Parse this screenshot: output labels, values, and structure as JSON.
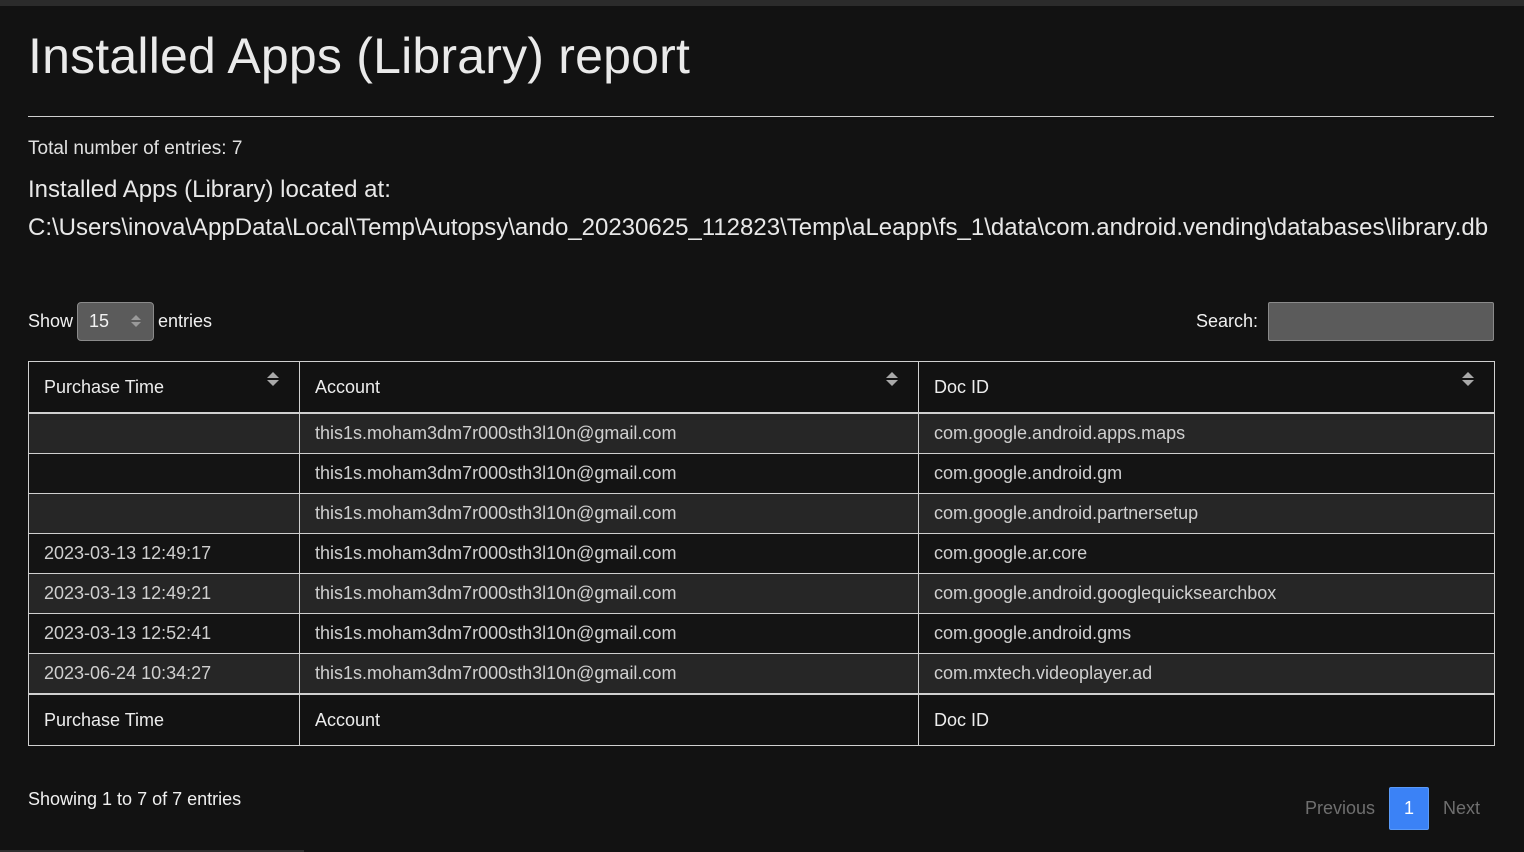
{
  "page": {
    "title": "Installed Apps (Library) report",
    "total_entries": "Total number of entries: 7",
    "location_label": "Installed Apps (Library) located at:",
    "location_path": "C:\\Users\\inova\\AppData\\Local\\Temp\\Autopsy\\ando_20230625_112823\\Temp\\aLeapp\\fs_1\\data\\com.android.vending\\databases\\library.db"
  },
  "controls": {
    "show_label": "Show",
    "show_value": "15",
    "entries_label": "entries",
    "search_label": "Search:",
    "search_value": ""
  },
  "table": {
    "columns": [
      "Purchase Time",
      "Account",
      "Doc ID"
    ],
    "rows": [
      [
        "",
        "this1s.moham3dm7r000sth3l10n@gmail.com",
        "com.google.android.apps.maps"
      ],
      [
        "",
        "this1s.moham3dm7r000sth3l10n@gmail.com",
        "com.google.android.gm"
      ],
      [
        "",
        "this1s.moham3dm7r000sth3l10n@gmail.com",
        "com.google.android.partnersetup"
      ],
      [
        "2023-03-13 12:49:17",
        "this1s.moham3dm7r000sth3l10n@gmail.com",
        "com.google.ar.core"
      ],
      [
        "2023-03-13 12:49:21",
        "this1s.moham3dm7r000sth3l10n@gmail.com",
        "com.google.android.googlequicksearchbox"
      ],
      [
        "2023-03-13 12:52:41",
        "this1s.moham3dm7r000sth3l10n@gmail.com",
        "com.google.android.gms"
      ],
      [
        "2023-06-24 10:34:27",
        "this1s.moham3dm7r000sth3l10n@gmail.com",
        "com.mxtech.videoplayer.ad"
      ]
    ]
  },
  "footer": {
    "info": "Showing 1 to 7 of 7 entries",
    "previous": "Previous",
    "current_page": "1",
    "next": "Next"
  },
  "colors": {
    "background": "#121212",
    "accent": "#3b82f6"
  }
}
